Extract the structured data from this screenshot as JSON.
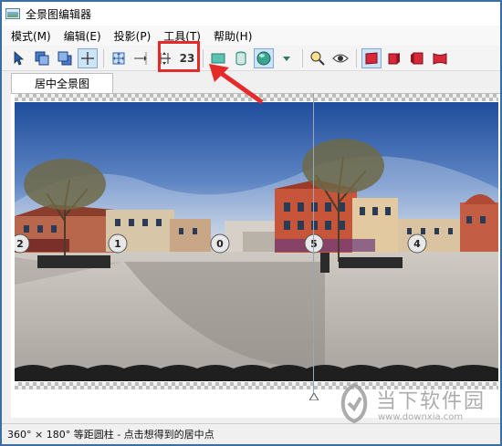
{
  "window": {
    "title": "全景图编辑器"
  },
  "menu": [
    {
      "label": "模式(M)"
    },
    {
      "label": "编辑(E)"
    },
    {
      "label": "投影(P)"
    },
    {
      "label": "工具(T)"
    },
    {
      "label": "帮助(H)"
    }
  ],
  "toolbar": {
    "number_label": "23",
    "icons": [
      "pointer-icon",
      "layers-front-icon",
      "layers-back-icon",
      "crosshair-icon",
      "fit-view-icon",
      "move-point-icon",
      "center-horizon-icon",
      "rectangle-projection-icon",
      "cylinder-projection-icon",
      "sphere-projection-icon",
      "dropdown-icon",
      "zoom-icon",
      "eye-icon",
      "red-flat-icon",
      "red-cube-icon",
      "red-cube-2-icon",
      "red-bent-icon"
    ]
  },
  "tab": {
    "label": "居中全景图"
  },
  "markers": [
    {
      "label": "2"
    },
    {
      "label": "1"
    },
    {
      "label": "0"
    },
    {
      "label": "5"
    },
    {
      "label": "4"
    }
  ],
  "status": {
    "text": "360° × 180° 等距圆柱 - 点击想得到的居中点"
  },
  "watermark": {
    "name": "当下软件园",
    "url": "www.downxia.com"
  },
  "colors": {
    "highlight": "#e52a2a",
    "sky": "#2f5fae",
    "ground": "#c9c6c0"
  }
}
